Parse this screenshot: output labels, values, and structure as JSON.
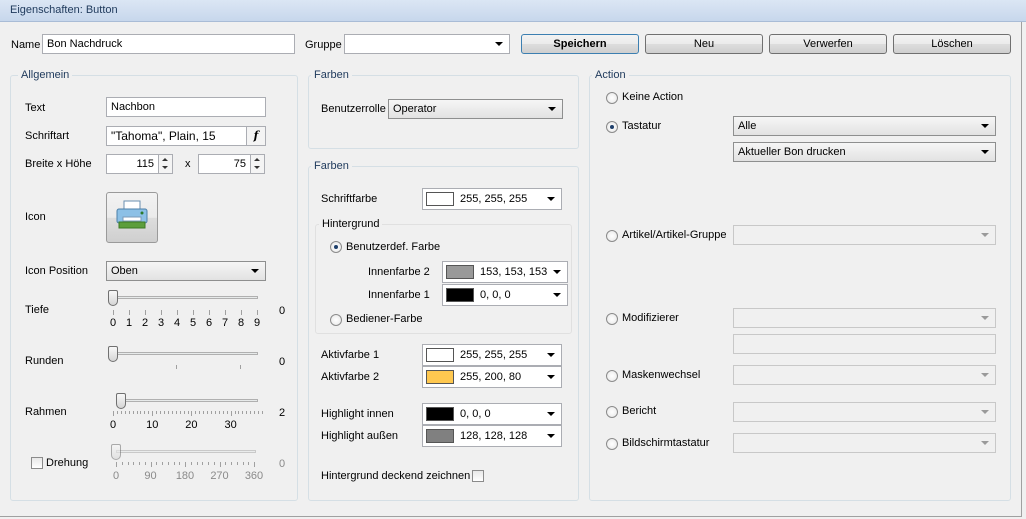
{
  "window": {
    "title": "Eigenschaften: Button"
  },
  "toolbar": {
    "name_label": "Name",
    "name_value": "Bon Nachdruck",
    "group_label": "Gruppe",
    "group_value": "",
    "save_label": "Speichern",
    "new_label": "Neu",
    "discard_label": "Verwerfen",
    "delete_label": "Löschen"
  },
  "general": {
    "title": "Allgemein",
    "text_label": "Text",
    "text_value": "Nachbon",
    "font_label": "Schriftart",
    "font_value": "\"Tahoma\", Plain, 15",
    "font_button": "f",
    "size_label": "Breite x Höhe",
    "width": "115",
    "x_label": "x",
    "height": "75",
    "icon_label": "Icon",
    "icon_name": "printer-icon",
    "icon_position_label": "Icon Position",
    "icon_position_value": "Oben",
    "depth": {
      "label": "Tiefe",
      "value": 0,
      "value_text": "0",
      "max": 9,
      "ticks": [
        "0",
        "1",
        "2",
        "3",
        "4",
        "5",
        "6",
        "7",
        "8",
        "9"
      ]
    },
    "rounding": {
      "label": "Runden",
      "value": 0,
      "value_text": "0"
    },
    "frame": {
      "label": "Rahmen",
      "value": 2,
      "value_text": "2",
      "max": 38,
      "ticks": [
        "0",
        "10",
        "20",
        "30"
      ]
    },
    "rotation": {
      "label": "Drehung",
      "checked": false,
      "value": 0,
      "value_text": "0",
      "max": 360,
      "ticks": [
        "0",
        "90",
        "180",
        "270",
        "360"
      ]
    }
  },
  "colors_top": {
    "title": "Farben",
    "role_label": "Benutzerrolle",
    "role_value": "Operator"
  },
  "colors": {
    "title": "Farben",
    "font_color_label": "Schriftfarbe",
    "font_color_value": "255, 255, 255",
    "font_color_hex": "#ffffff",
    "background_title": "Hintergrund",
    "custom_color_label": "Benutzerdef. Farbe",
    "inner2_label": "Innenfarbe 2",
    "inner2_value": "153, 153, 153",
    "inner2_hex": "#999999",
    "inner1_label": "Innenfarbe 1",
    "inner1_value": "0, 0, 0",
    "inner1_hex": "#000000",
    "operator_color_label": "Bediener-Farbe",
    "active1_label": "Aktivfarbe 1",
    "active1_value": "255, 255, 255",
    "active1_hex": "#ffffff",
    "active2_label": "Aktivfarbe 2",
    "active2_value": "255, 200, 80",
    "active2_hex": "#ffc850",
    "highlight_inner_label": "Highlight innen",
    "highlight_inner_value": "0, 0, 0",
    "highlight_inner_hex": "#000000",
    "highlight_outer_label": "Highlight außen",
    "highlight_outer_value": "128, 128, 128",
    "highlight_outer_hex": "#808080",
    "opaque_label": "Hintergrund deckend zeichnen"
  },
  "action": {
    "title": "Action",
    "no_action_label": "Keine Action",
    "keyboard_label": "Tastatur",
    "keyboard_value1": "Alle",
    "keyboard_value2": "Aktueller Bon drucken",
    "article_label": "Artikel/Artikel-Gruppe",
    "modifier_label": "Modifizierer",
    "mask_label": "Maskenwechsel",
    "report_label": "Bericht",
    "screen_keyboard_label": "Bildschirmtastatur"
  }
}
